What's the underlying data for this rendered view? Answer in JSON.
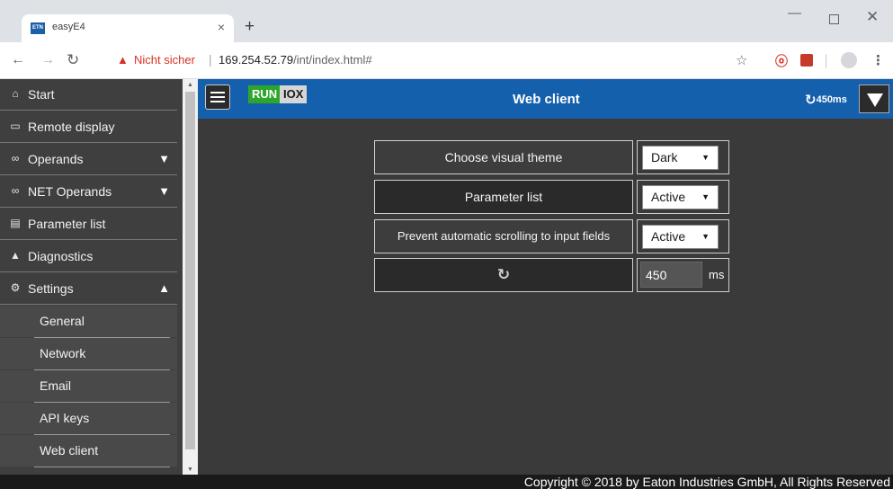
{
  "browser": {
    "tab_title": "easyE4",
    "tab_favicon": "ETN",
    "security_warning": "Nicht sicher",
    "url_host": "169.254.52.79",
    "url_path": "/int/index.html#"
  },
  "sidebar": {
    "items": [
      {
        "label": "Start",
        "icon": "home-icon",
        "glyph": "🏠"
      },
      {
        "label": "Remote display",
        "icon": "monitor-icon",
        "glyph": "🖵"
      },
      {
        "label": "Operands",
        "icon": "infinity-icon",
        "glyph": "∞",
        "arrow": "▼"
      },
      {
        "label": "NET Operands",
        "icon": "infinity-icon",
        "glyph": "∞",
        "arrow": "▼"
      },
      {
        "label": "Parameter list",
        "icon": "list-icon",
        "glyph": "▤"
      },
      {
        "label": "Diagnostics",
        "icon": "warning-icon",
        "glyph": "▲"
      },
      {
        "label": "Settings",
        "icon": "gear-icon",
        "glyph": "⚙",
        "arrow": "▲"
      }
    ],
    "settings_subitems": [
      "General",
      "Network",
      "Email",
      "API keys",
      "Web client"
    ]
  },
  "header": {
    "run_label": "RUN",
    "iox_label": "IOX",
    "title": "Web client",
    "refresh_rate": "450ms"
  },
  "settings": {
    "theme_label": "Choose visual theme",
    "theme_value": "Dark",
    "param_label": "Parameter list",
    "param_value": "Active",
    "scroll_label": "Prevent automatic scrolling to input fields",
    "scroll_value": "Active",
    "refresh_value": "450",
    "refresh_unit": "ms"
  },
  "footer": {
    "copyright": "Copyright © 2018 by Eaton Industries GmbH, All Rights Reserved"
  },
  "colors": {
    "header_blue": "#1560ad",
    "run_green": "#2ea62e",
    "app_background": "#3a3a3a"
  }
}
